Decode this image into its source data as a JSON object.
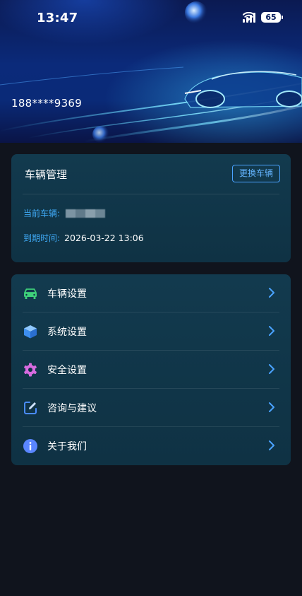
{
  "status_bar": {
    "time": "13:47",
    "battery": "65"
  },
  "banner": {
    "phone": "188****9369"
  },
  "vehicle_card": {
    "title": "车辆管理",
    "change_button": "更换车辆",
    "current_vehicle_label": "当前车辆:",
    "expire_label": "到期时间:",
    "expire_value": "2026-03-22 13:06"
  },
  "menu": {
    "items": [
      {
        "label": "车辆设置",
        "icon": "car-icon"
      },
      {
        "label": "系统设置",
        "icon": "cube-icon"
      },
      {
        "label": "安全设置",
        "icon": "gear-icon"
      },
      {
        "label": "咨询与建议",
        "icon": "edit-icon"
      },
      {
        "label": "关于我们",
        "icon": "info-icon"
      }
    ]
  },
  "colors": {
    "accent": "#3fa9f5",
    "card_bg": "#123a4e",
    "page_bg": "#10141d",
    "car_icon": "#3ecf7a",
    "cube_icon": "#4aa3ff",
    "gear_icon": "#d76be0",
    "edit_icon": "#4a8cff",
    "info_icon": "#5a86ff"
  }
}
